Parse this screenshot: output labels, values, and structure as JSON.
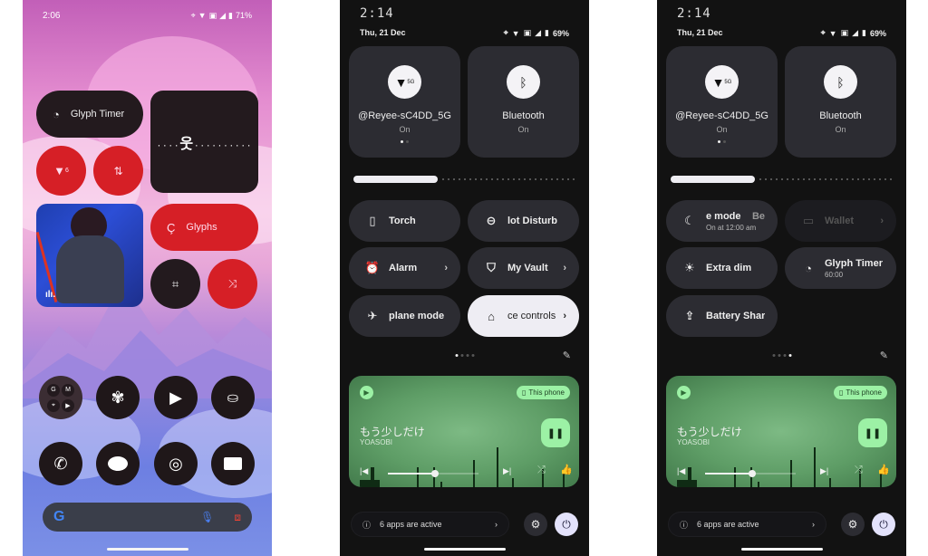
{
  "home": {
    "status": {
      "time": "2:06",
      "battery": "71%",
      "icons": [
        "location-icon",
        "wifi-icon",
        "sim-icon",
        "signal-icon",
        "battery-icon"
      ]
    },
    "widgets": {
      "glyph_timer_label": "Glyph Timer",
      "glyphs_label": "Glyphs",
      "wifi_toggle_badge": "6",
      "data_toggle_icon": "data-transfer-icon"
    },
    "apps_row1": [
      {
        "name": "google-apps-folder",
        "folder_items": [
          "G",
          "M",
          "maps",
          "yt"
        ]
      },
      {
        "name": "pinwheel-app",
        "glyph": "✾"
      },
      {
        "name": "play-store-app",
        "glyph": "▶"
      },
      {
        "name": "store-app",
        "glyph": "🛍"
      }
    ],
    "apps_row2": [
      {
        "name": "phone-app",
        "glyph": "✆"
      },
      {
        "name": "messages-app",
        "glyph": "💬"
      },
      {
        "name": "chrome-app",
        "glyph": "◎"
      },
      {
        "name": "camera-app",
        "glyph": "◼"
      }
    ],
    "search": {
      "logo": "G"
    }
  },
  "qs1": {
    "clock": "2:14",
    "date": "Thu, 21 Dec",
    "battery": "69%",
    "wifi": {
      "title": "@Reyee-sC4DD_5G",
      "status": "On",
      "badge": "5G"
    },
    "bluetooth": {
      "title": "Bluetooth",
      "status": "On"
    },
    "brightness_percent": 38,
    "tiles": [
      {
        "label": "Torch",
        "icon": "▯",
        "chev": false,
        "style": ""
      },
      {
        "label": "lot Disturb",
        "icon": "⊖",
        "chev": false,
        "style": ""
      },
      {
        "label": "Alarm",
        "icon": "⏰",
        "chev": true,
        "style": ""
      },
      {
        "label": "My Vault",
        "icon": "⛉",
        "chev": true,
        "style": ""
      },
      {
        "label": "plane mode",
        "icon": "✈",
        "chev": false,
        "style": ""
      },
      {
        "label": "ce controls",
        "icon": "⌂",
        "chev": true,
        "style": "light"
      }
    ],
    "page_index": 0,
    "page_count": 4
  },
  "qs2": {
    "clock": "2:14",
    "date": "Thu, 21 Dec",
    "battery": "69%",
    "wifi": {
      "title": "@Reyee-sC4DD_5G",
      "status": "On",
      "badge": "5G"
    },
    "bluetooth": {
      "title": "Bluetooth",
      "status": "On"
    },
    "brightness_percent": 38,
    "tiles": [
      {
        "label": "e mode",
        "extra": "Be",
        "sub": "On at 12:00 am",
        "icon": "☾",
        "chev": false,
        "style": ""
      },
      {
        "label": "Wallet",
        "icon": "▭",
        "chev": true,
        "style": "dim"
      },
      {
        "label": "Extra dim",
        "icon": "☀",
        "chev": false,
        "style": ""
      },
      {
        "label": "Glyph Timer",
        "sub": "60:00",
        "icon": "◔",
        "chev": false,
        "style": ""
      },
      {
        "label": "Battery Share",
        "icon": "⇪",
        "chev": false,
        "style": ""
      }
    ],
    "page_index": 3,
    "page_count": 4
  },
  "media": {
    "title": "もう少しだけ",
    "artist": "YOASOBI",
    "output": "This phone",
    "progress_percent": 52,
    "pause_label": "❚❚",
    "prev": "|◀",
    "next": "▶|",
    "shuffle": "⤮",
    "like": "👍"
  },
  "footer": {
    "active_apps": "6 apps are active",
    "chevron": "›"
  },
  "colors": {
    "accent_red": "#d61f26",
    "media_green": "#9cf1a5",
    "tile_bg": "#2c2c32"
  }
}
